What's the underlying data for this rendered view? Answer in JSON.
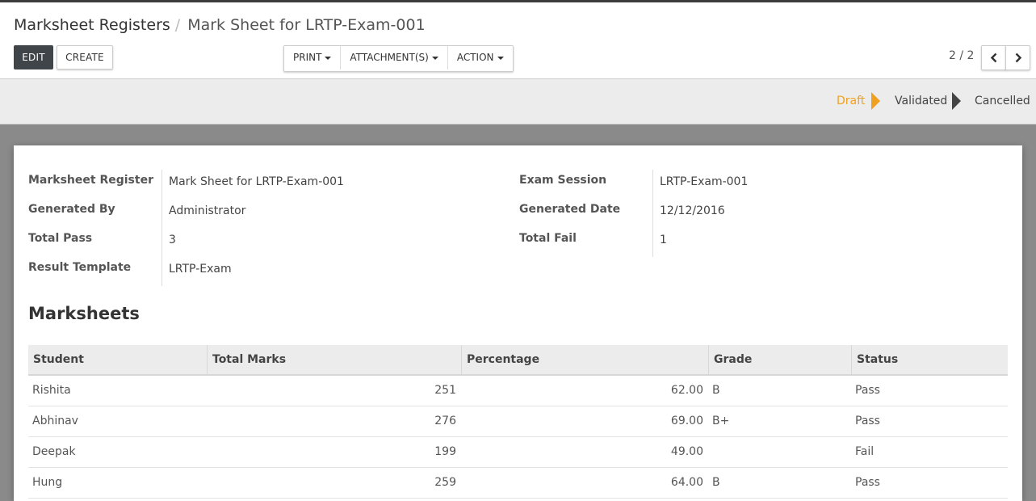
{
  "breadcrumb": {
    "root": "Marksheet Registers",
    "separator": "/",
    "current": "Mark Sheet for LRTP-Exam-001"
  },
  "toolbar": {
    "edit_label": "EDIT",
    "create_label": "CREATE",
    "print_label": "PRINT",
    "attachments_label": "ATTACHMENT(S)",
    "action_label": "ACTION"
  },
  "pager": {
    "value": "2 / 2"
  },
  "statusbar": {
    "stages": [
      "Draft",
      "Validated",
      "Cancelled"
    ],
    "active": "Draft",
    "active_color": "#f0a020"
  },
  "form": {
    "left": [
      {
        "label": "Marksheet Register",
        "value": "Mark Sheet for LRTP-Exam-001"
      },
      {
        "label": "Generated By",
        "value": "Administrator"
      },
      {
        "label": "Total Pass",
        "value": "3"
      },
      {
        "label": "Result Template",
        "value": "LRTP-Exam"
      }
    ],
    "right": [
      {
        "label": "Exam Session",
        "value": "LRTP-Exam-001"
      },
      {
        "label": "Generated Date",
        "value": "12/12/2016"
      },
      {
        "label": "Total Fail",
        "value": "1"
      }
    ]
  },
  "marksheets": {
    "title": "Marksheets",
    "columns": [
      "Student",
      "Total Marks",
      "Percentage",
      "Grade",
      "Status"
    ],
    "rows": [
      {
        "student": "Rishita",
        "total_marks": "251",
        "percentage": "62.00",
        "grade": "B",
        "status": "Pass"
      },
      {
        "student": "Abhinav",
        "total_marks": "276",
        "percentage": "69.00",
        "grade": "B+",
        "status": "Pass"
      },
      {
        "student": "Deepak",
        "total_marks": "199",
        "percentage": "49.00",
        "grade": "",
        "status": "Fail"
      },
      {
        "student": "Hung",
        "total_marks": "259",
        "percentage": "64.00",
        "grade": "B",
        "status": "Pass"
      }
    ]
  }
}
